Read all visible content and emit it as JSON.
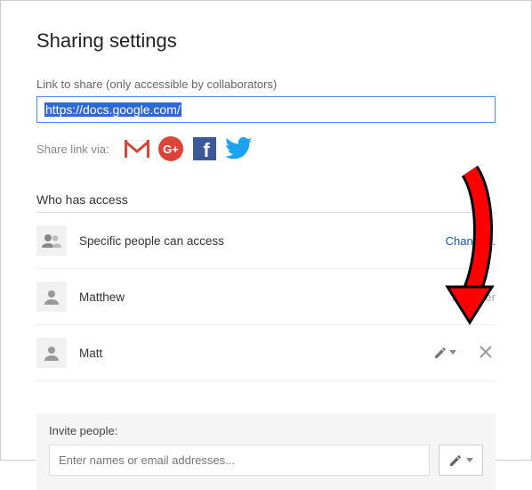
{
  "title": "Sharing settings",
  "link": {
    "label": "Link to share (only accessible by collaborators)",
    "value": "https://docs.google.com/"
  },
  "shareVia": {
    "label": "Share link via:",
    "icons": [
      "gmail",
      "google-plus",
      "facebook",
      "twitter"
    ]
  },
  "access": {
    "title": "Who has access",
    "rows": [
      {
        "icon": "group",
        "text": "Specific people can access",
        "action": {
          "type": "link",
          "label": "Change..."
        }
      },
      {
        "icon": "person",
        "text": "Matthew",
        "action": {
          "type": "status",
          "label": "Is owner"
        }
      },
      {
        "icon": "person",
        "text": "Matt",
        "action": {
          "type": "edit-remove"
        }
      }
    ]
  },
  "invite": {
    "label": "Invite people:",
    "placeholder": "Enter names or email addresses..."
  }
}
